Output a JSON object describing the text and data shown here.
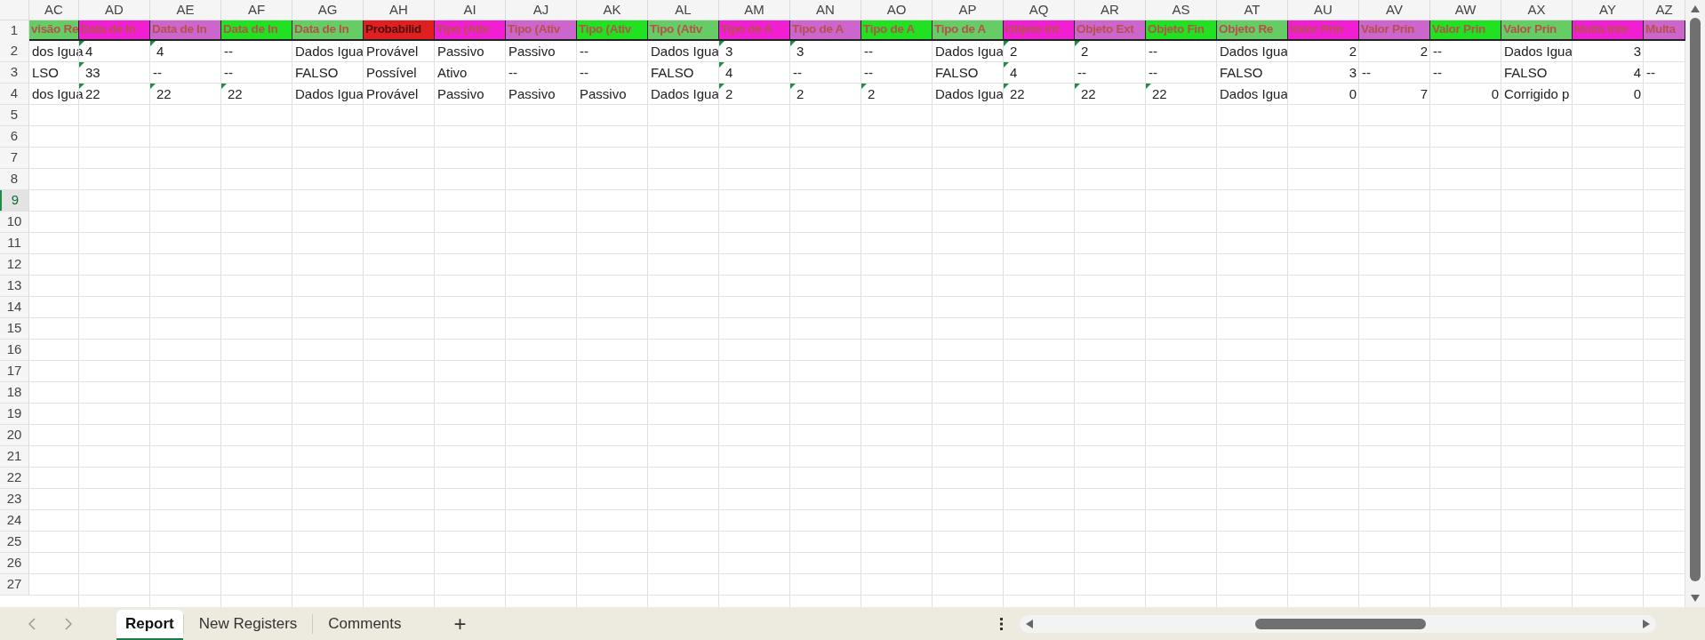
{
  "columns": [
    {
      "letter": "AC",
      "header": "visão Re",
      "color": "#66cc66"
    },
    {
      "letter": "AD",
      "header": "Data de In",
      "color": "#f01fd2"
    },
    {
      "letter": "AE",
      "header": "Data de In",
      "color": "#cc66cc"
    },
    {
      "letter": "AF",
      "header": "Data de In",
      "color": "#22e022"
    },
    {
      "letter": "AG",
      "header": "Data de In",
      "color": "#66cc66"
    },
    {
      "letter": "AH",
      "header": "Probabilid",
      "color": "#e02020"
    },
    {
      "letter": "AI",
      "header": "Tipo (Ativ",
      "color": "#f01fd2"
    },
    {
      "letter": "AJ",
      "header": "Tipo (Ativ",
      "color": "#cc66cc"
    },
    {
      "letter": "AK",
      "header": "Tipo (Ativ",
      "color": "#22e022"
    },
    {
      "letter": "AL",
      "header": "Tipo (Ativ",
      "color": "#66cc66"
    },
    {
      "letter": "AM",
      "header": "Tipo de A",
      "color": "#f01fd2"
    },
    {
      "letter": "AN",
      "header": "Tipo de A",
      "color": "#cc66cc"
    },
    {
      "letter": "AO",
      "header": "Tipo de A",
      "color": "#22e022"
    },
    {
      "letter": "AP",
      "header": "Tipo de A",
      "color": "#66cc66"
    },
    {
      "letter": "AQ",
      "header": "Objeto Int",
      "color": "#f01fd2"
    },
    {
      "letter": "AR",
      "header": "Objeto Ext",
      "color": "#cc66cc"
    },
    {
      "letter": "AS",
      "header": "Objeto Fin",
      "color": "#22e022"
    },
    {
      "letter": "AT",
      "header": "Objeto Re",
      "color": "#66cc66"
    },
    {
      "letter": "AU",
      "header": "Valor Prin",
      "color": "#f01fd2"
    },
    {
      "letter": "AV",
      "header": "Valor Prin",
      "color": "#cc66cc"
    },
    {
      "letter": "AW",
      "header": "Valor Prin",
      "color": "#22e022"
    },
    {
      "letter": "AX",
      "header": "Valor Prin",
      "color": "#66cc66"
    },
    {
      "letter": "AY",
      "header": "Multa Inte",
      "color": "#f01fd2"
    },
    {
      "letter": "AZ",
      "header": "Multa",
      "color": "#cc66cc"
    }
  ],
  "rows": [
    [
      {
        "t": "dos Igua",
        "kind": "text"
      },
      {
        "t": "4",
        "kind": "flagged"
      },
      {
        "t": "4",
        "kind": "flagged"
      },
      {
        "t": "--",
        "kind": "text"
      },
      {
        "t": "Dados Igua",
        "kind": "text"
      },
      {
        "t": "Provável",
        "kind": "text"
      },
      {
        "t": "Passivo",
        "kind": "text"
      },
      {
        "t": "Passivo",
        "kind": "text"
      },
      {
        "t": "--",
        "kind": "text"
      },
      {
        "t": "Dados Igua",
        "kind": "text"
      },
      {
        "t": "3",
        "kind": "flagged"
      },
      {
        "t": "3",
        "kind": "flagged"
      },
      {
        "t": "--",
        "kind": "text"
      },
      {
        "t": "Dados Igua",
        "kind": "text"
      },
      {
        "t": "2",
        "kind": "flagged"
      },
      {
        "t": "2",
        "kind": "flagged"
      },
      {
        "t": "--",
        "kind": "text"
      },
      {
        "t": "Dados Igua",
        "kind": "text"
      },
      {
        "t": "2",
        "kind": "number"
      },
      {
        "t": "2",
        "kind": "number"
      },
      {
        "t": "--",
        "kind": "text"
      },
      {
        "t": "Dados Igua",
        "kind": "text"
      },
      {
        "t": "3",
        "kind": "number"
      },
      null
    ],
    [
      {
        "t": "LSO",
        "kind": "text"
      },
      {
        "t": "33",
        "kind": "flagged"
      },
      {
        "t": "--",
        "kind": "text"
      },
      {
        "t": "--",
        "kind": "text"
      },
      {
        "t": "FALSO",
        "kind": "text"
      },
      {
        "t": "Possível",
        "kind": "text"
      },
      {
        "t": "Ativo",
        "kind": "text"
      },
      {
        "t": "--",
        "kind": "text"
      },
      {
        "t": "--",
        "kind": "text"
      },
      {
        "t": "FALSO",
        "kind": "text"
      },
      {
        "t": "4",
        "kind": "flagged"
      },
      {
        "t": "--",
        "kind": "text"
      },
      {
        "t": "--",
        "kind": "text"
      },
      {
        "t": "FALSO",
        "kind": "text"
      },
      {
        "t": "4",
        "kind": "flagged"
      },
      {
        "t": "--",
        "kind": "text"
      },
      {
        "t": "--",
        "kind": "text"
      },
      {
        "t": "FALSO",
        "kind": "text"
      },
      {
        "t": "3",
        "kind": "number"
      },
      {
        "t": "--",
        "kind": "text"
      },
      {
        "t": "--",
        "kind": "text"
      },
      {
        "t": "FALSO",
        "kind": "text"
      },
      {
        "t": "4",
        "kind": "number"
      },
      {
        "t": "--",
        "kind": "text"
      }
    ],
    [
      {
        "t": "dos Igua",
        "kind": "text"
      },
      {
        "t": "22",
        "kind": "flagged"
      },
      {
        "t": "22",
        "kind": "flagged"
      },
      {
        "t": "22",
        "kind": "flagged"
      },
      {
        "t": "Dados Igua",
        "kind": "text"
      },
      {
        "t": "Provável",
        "kind": "text"
      },
      {
        "t": "Passivo",
        "kind": "text"
      },
      {
        "t": "Passivo",
        "kind": "text"
      },
      {
        "t": "Passivo",
        "kind": "text"
      },
      {
        "t": "Dados Igua",
        "kind": "text"
      },
      {
        "t": "2",
        "kind": "flagged"
      },
      {
        "t": "2",
        "kind": "flagged"
      },
      {
        "t": "2",
        "kind": "flagged"
      },
      {
        "t": "Dados Igua",
        "kind": "text"
      },
      {
        "t": "22",
        "kind": "flagged"
      },
      {
        "t": "22",
        "kind": "flagged"
      },
      {
        "t": "22",
        "kind": "flagged"
      },
      {
        "t": "Dados Igua",
        "kind": "text"
      },
      {
        "t": "0",
        "kind": "number"
      },
      {
        "t": "7",
        "kind": "number"
      },
      {
        "t": "0",
        "kind": "number"
      },
      {
        "t": "Corrigido p",
        "kind": "text"
      },
      {
        "t": "0",
        "kind": "number"
      },
      null
    ]
  ],
  "row_numbers": [
    {
      "label": "1",
      "selected": false
    },
    {
      "label": "2",
      "selected": false
    },
    {
      "label": "3",
      "selected": false
    },
    {
      "label": "4",
      "selected": false
    },
    {
      "label": "5",
      "selected": false
    },
    {
      "label": "6",
      "selected": false
    },
    {
      "label": "7",
      "selected": false
    },
    {
      "label": "8",
      "selected": false
    },
    {
      "label": "9",
      "selected": true
    },
    {
      "label": "10",
      "selected": false
    },
    {
      "label": "11",
      "selected": false
    },
    {
      "label": "12",
      "selected": false
    },
    {
      "label": "13",
      "selected": false
    },
    {
      "label": "14",
      "selected": false
    },
    {
      "label": "15",
      "selected": false
    },
    {
      "label": "16",
      "selected": false
    },
    {
      "label": "17",
      "selected": false
    },
    {
      "label": "18",
      "selected": false
    },
    {
      "label": "19",
      "selected": false
    },
    {
      "label": "20",
      "selected": false
    },
    {
      "label": "21",
      "selected": false
    },
    {
      "label": "22",
      "selected": false
    },
    {
      "label": "23",
      "selected": false
    },
    {
      "label": "24",
      "selected": false
    },
    {
      "label": "25",
      "selected": false
    },
    {
      "label": "26",
      "selected": false
    },
    {
      "label": "27",
      "selected": false
    }
  ],
  "sheet_tabs": [
    {
      "label": "Report",
      "selected": true
    },
    {
      "label": "New Registers",
      "selected": false
    },
    {
      "label": "Comments",
      "selected": false
    }
  ],
  "add_sheet": "+"
}
